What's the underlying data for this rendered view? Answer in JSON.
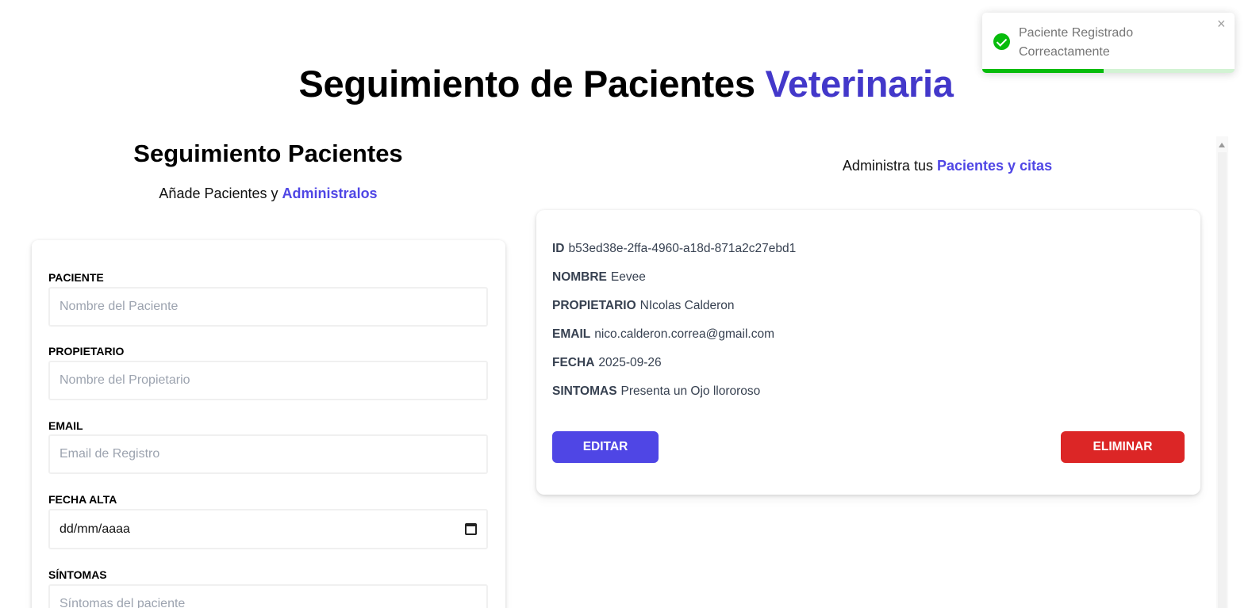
{
  "header": {
    "title_main": "Seguimiento de Pacientes",
    "title_accent": "Veterinaria"
  },
  "form_section": {
    "heading": "Seguimiento Pacientes",
    "subtitle_text": "Añade Pacientes y",
    "subtitle_accent": "Administralos",
    "fields": {
      "paciente": {
        "label": "PACIENTE",
        "placeholder": "Nombre del Paciente"
      },
      "propietario": {
        "label": "PROPIETARIO",
        "placeholder": "Nombre del Propietario"
      },
      "email": {
        "label": "EMAIL",
        "placeholder": "Email de Registro"
      },
      "fecha": {
        "label": "FECHA ALTA",
        "value": "dd/mm/aaaa"
      },
      "sintomas": {
        "label": "SÍNTOMAS",
        "placeholder": "Síntomas del paciente"
      }
    }
  },
  "list_section": {
    "subtitle_text": "Administra tus",
    "subtitle_accent": "Pacientes y citas",
    "patient": {
      "id_label": "ID",
      "id": "b53ed38e-2ffa-4960-a18d-871a2c27ebd1",
      "nombre_label": "NOMBRE",
      "nombre": "Eevee",
      "propietario_label": "PROPIETARIO",
      "propietario": "NIcolas Calderon",
      "email_label": "EMAIL",
      "email": "nico.calderon.correa@gmail.com",
      "fecha_label": "FECHA",
      "fecha": "2025-09-26",
      "sintomas_label": "SINTOMAS",
      "sintomas": "Presenta un Ojo llororoso",
      "edit_label": "EDITAR",
      "delete_label": "ELIMINAR"
    }
  },
  "toast": {
    "line1": "Paciente Registrado",
    "line2": "Correactamente",
    "close": "×",
    "icon": "check-circle-icon",
    "progress_fraction": 0.48,
    "color": "#07bc0c"
  },
  "colors": {
    "accent": "#4338ca",
    "edit_button": "#4f46e5",
    "delete_button": "#dc2626"
  }
}
